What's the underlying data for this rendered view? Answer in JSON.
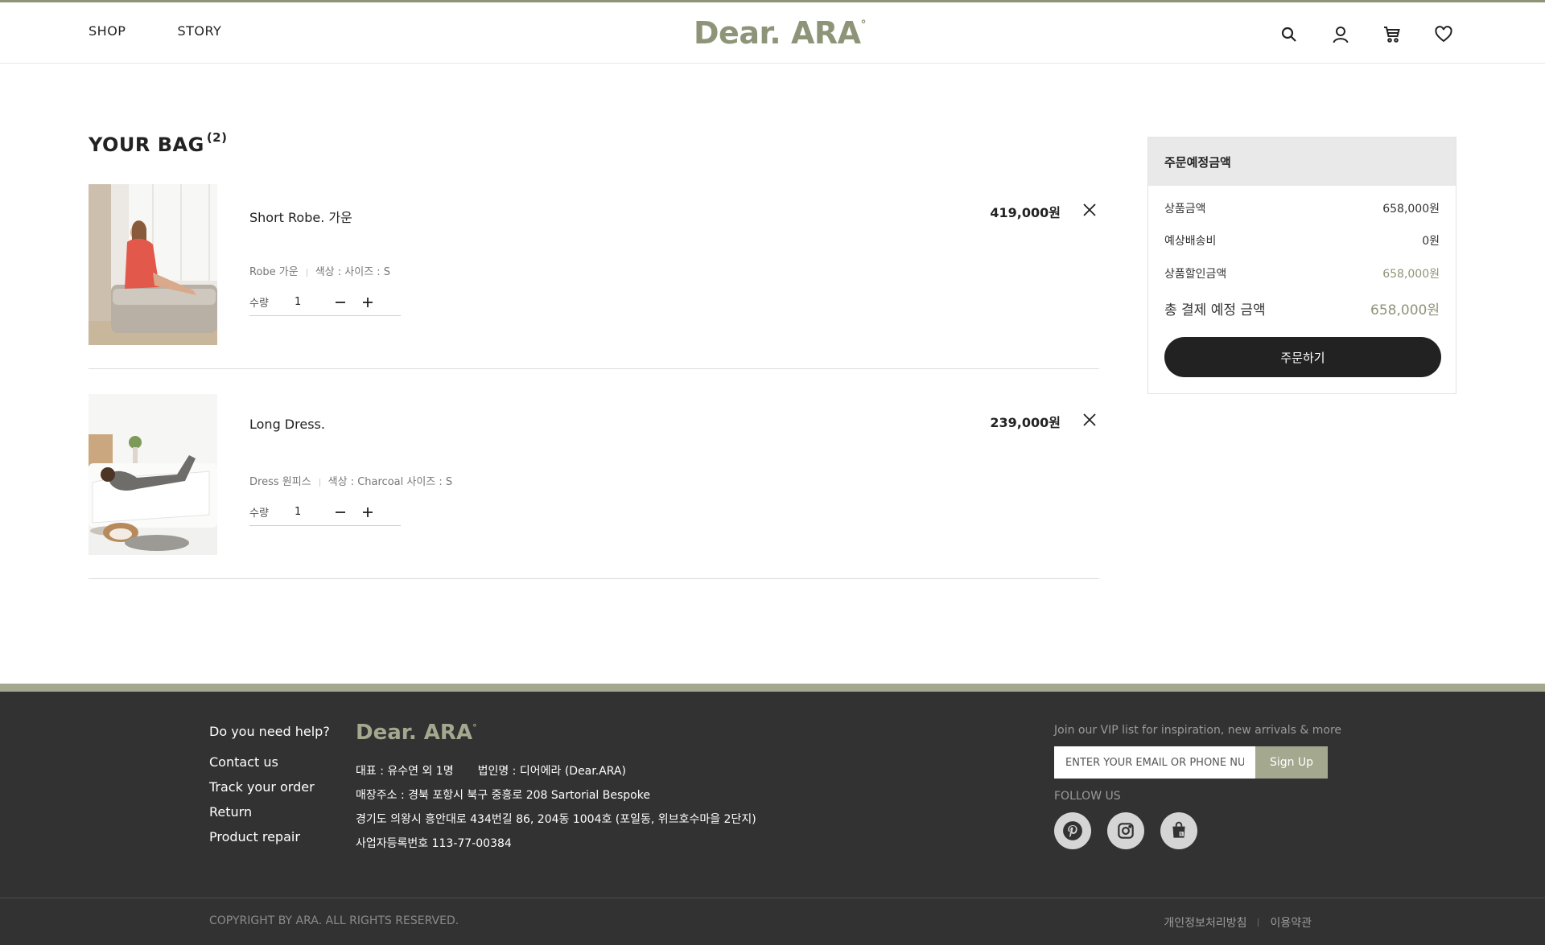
{
  "header": {
    "nav": [
      "SHOP",
      "STORY"
    ],
    "logo": "Dear. ARA",
    "logo_mark": "°"
  },
  "bag": {
    "title": "YOUR BAG",
    "count": "(2)",
    "qty_label": "수량",
    "items": [
      {
        "name": "Short Robe. 가운",
        "category": "Robe 가운",
        "options": "색상 : 사이즈 : S",
        "quantity": "1",
        "price": "419,000원"
      },
      {
        "name": "Long Dress.",
        "category": "Dress 원피스",
        "options": "색상 : Charcoal 사이즈 : S",
        "quantity": "1",
        "price": "239,000원"
      }
    ]
  },
  "summary": {
    "title": "주문예정금액",
    "rows": [
      {
        "label": "상품금액",
        "value": "658,000원"
      },
      {
        "label": "예상배송비",
        "value": "0원"
      },
      {
        "label": "상품할인금액",
        "value": "658,000원"
      }
    ],
    "total_label": "총 결제 예정 금액",
    "total_value": "658,000원",
    "order_button": "주문하기"
  },
  "footer": {
    "help_title": "Do you need help?",
    "help_links": [
      "Contact us",
      "Track your order",
      "Return",
      "Product repair"
    ],
    "logo": "Dear. ARA",
    "logo_mark": "°",
    "company": {
      "ceo": "대표 : 유수연 외 1명",
      "corp": "법인명 : 디어에라 (Dear.ARA)",
      "store_address": "매장주소 : 경북 포항시 북구 중흥로 208 Sartorial Bespoke",
      "address2": "경기도 의왕시 흥안대로 434번길 86, 204동 1004호 (포일동, 위브호수마을 2단지)",
      "biz_no": "사업자등록번호 113-77-00384"
    },
    "vip_title": "Join our VIP list for inspiration, new arrivals & more",
    "email_placeholder": "ENTER YOUR EMAIL OR PHONE NUMBER",
    "signup": "Sign Up",
    "follow": "FOLLOW US",
    "socials": [
      "pinterest-icon",
      "instagram-icon",
      "shopping-bag-icon"
    ],
    "copyright": "COPYRIGHT BY ARA. ALL RIGHTS RESERVED.",
    "legal": [
      "개인정보처리방침",
      "이용약관"
    ]
  },
  "colors": {
    "accent": "#8e9478",
    "footer_bg": "#323232",
    "footer_band": "#a3a88e",
    "button_dark": "#222222"
  }
}
